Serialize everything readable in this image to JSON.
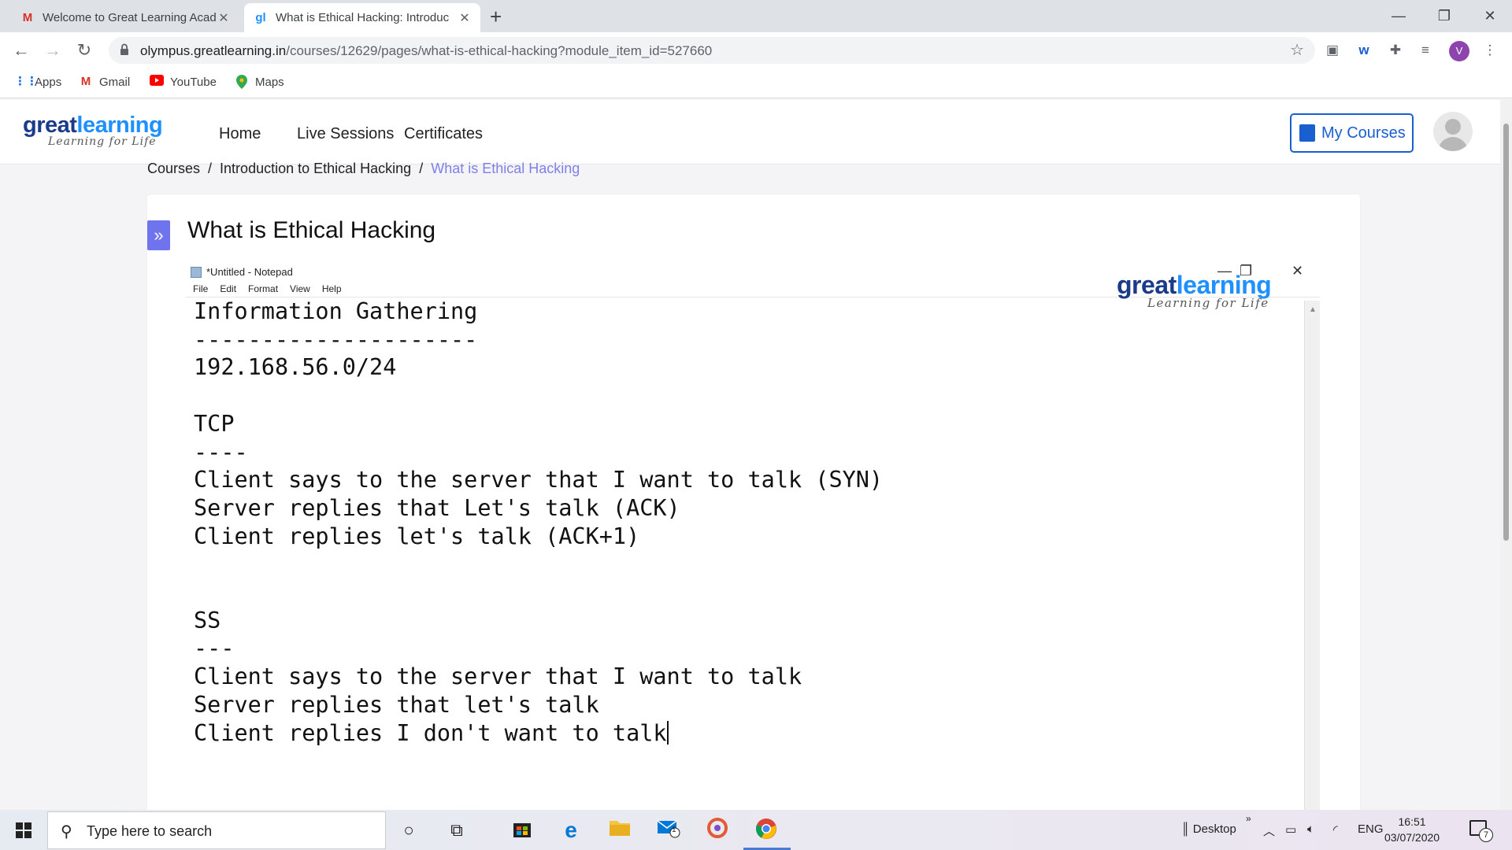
{
  "browser": {
    "tabs": [
      {
        "favicon": "M",
        "title": "Welcome to Great Learning Acad",
        "active": false
      },
      {
        "favicon": "gl",
        "title": "What is Ethical Hacking: Introduc",
        "active": true
      }
    ],
    "new_tab_icon": "+",
    "window_controls": {
      "minimize": "—",
      "maximize": "❐",
      "close": "✕"
    },
    "nav": {
      "back": "←",
      "forward": "→",
      "reload": "↻"
    },
    "url": {
      "domain": "olympus.greatlearning.in",
      "path": "/courses/12629/pages/what-is-ethical-hacking?module_item_id=527660"
    },
    "profile_initial": "V",
    "bookmarks": [
      {
        "icon": "apps-grid-icon",
        "label": "Apps"
      },
      {
        "icon": "gmail-icon",
        "label": "Gmail"
      },
      {
        "icon": "youtube-icon",
        "label": "YouTube"
      },
      {
        "icon": "maps-icon",
        "label": "Maps"
      }
    ]
  },
  "site": {
    "logo": {
      "part1": "great",
      "part2": "learning",
      "tagline": "Learning for Life"
    },
    "nav": {
      "home": "Home",
      "live_sessions": "Live Sessions",
      "certificates": "Certificates"
    },
    "my_courses": "My Courses"
  },
  "breadcrumb": {
    "courses": "Courses",
    "module": "Introduction to Ethical Hacking",
    "current": "What is Ethical Hacking",
    "separator": "/"
  },
  "page": {
    "title": "What is Ethical Hacking",
    "sidebar_toggle": "»"
  },
  "video": {
    "notepad_title": "*Untitled - Notepad",
    "menu": [
      "File",
      "Edit",
      "Format",
      "View",
      "Help"
    ],
    "watermark": {
      "part1": "great",
      "part2": "learning",
      "tagline": "Learning for Life"
    },
    "text": "Information Gathering\n---------------------\n192.168.56.0/24\n\nTCP\n----\nClient says to the server that I want to talk (SYN)\nServer replies that Let's talk (ACK)\nClient replies let's talk (ACK+1)\n\n\nSS\n---\nClient says to the server that I want to talk\nServer replies that let's talk\nClient replies I don't want to talk"
  },
  "taskbar": {
    "search_placeholder": "Type here to search",
    "desktop_label": "Desktop",
    "language": "ENG",
    "time": "16:51",
    "date": "03/07/2020",
    "mail_badge": "1",
    "notification_count": "7"
  },
  "colors": {
    "brand_dark": "#1a3a8a",
    "brand_light": "#1e90ff",
    "accent_purple": "#6f73ee",
    "breadcrumb_current": "#7f7fe8"
  }
}
